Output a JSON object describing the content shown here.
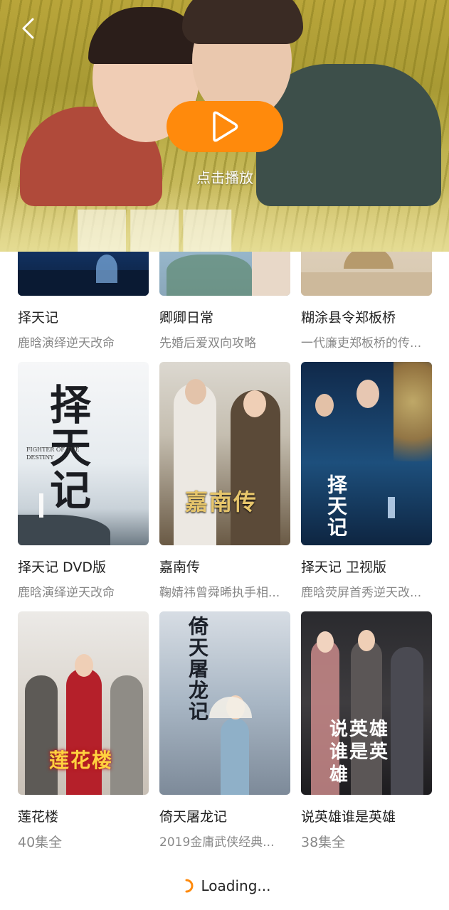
{
  "header": {
    "play_label": "点击播放",
    "icons": {
      "back": "chevron-left-icon",
      "play": "play-icon"
    },
    "accent_color": "#ff8a0c"
  },
  "items": [
    {
      "title": "择天记",
      "subtitle": "鹿晗演绎逆天改命"
    },
    {
      "title": "卿卿日常",
      "subtitle": "先婚后爱双向攻略"
    },
    {
      "title": "糊涂县令郑板桥",
      "subtitle": "一代廉吏郑板桥的传..."
    },
    {
      "title": "择天记 DVD版",
      "subtitle": "鹿晗演绎逆天改命",
      "poster_text": "择天记",
      "poster_en": "FIGHTER OF THE DESTINY"
    },
    {
      "title": "嘉南传",
      "subtitle": "鞠婧祎曾舜晞执手相...",
      "poster_text": "嘉南传"
    },
    {
      "title": "择天记 卫视版",
      "subtitle": "鹿晗荧屏首秀逆天改...",
      "poster_text": "择天记"
    },
    {
      "title": "莲花楼",
      "subtitle": "40集全",
      "poster_text": "莲花楼"
    },
    {
      "title": "倚天屠龙记",
      "subtitle": "2019金庸武侠经典...",
      "poster_text": "倚天屠龙记"
    },
    {
      "title": "说英雄谁是英雄",
      "subtitle": "38集全",
      "poster_text": "说英雄谁是英雄"
    }
  ],
  "footer": {
    "loading_text": "Loading...",
    "icon": "spinner-icon"
  }
}
